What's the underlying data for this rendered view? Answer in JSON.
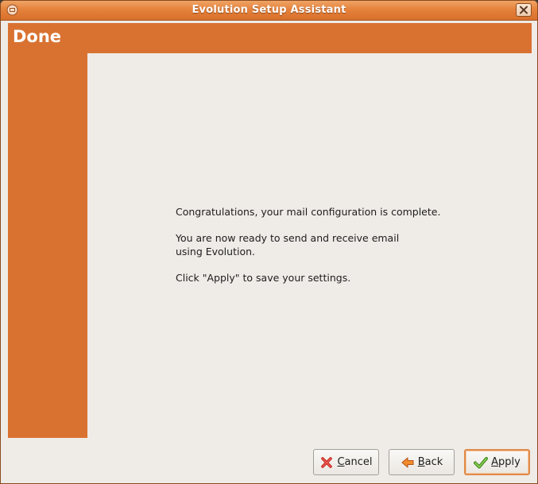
{
  "window": {
    "title": "Evolution Setup Assistant"
  },
  "header": {
    "title": "Done"
  },
  "content": {
    "line1": "Congratulations, your mail configuration is complete.",
    "line2": "You are now ready to send and receive email\nusing Evolution.",
    "line3": "Click \"Apply\" to save your settings."
  },
  "buttons": {
    "cancel_label": "Cancel",
    "back_label": "Back",
    "apply_label": "Apply"
  },
  "colors": {
    "accent": "#d97230",
    "background": "#efebe7",
    "titlebar": "#e5823c"
  }
}
